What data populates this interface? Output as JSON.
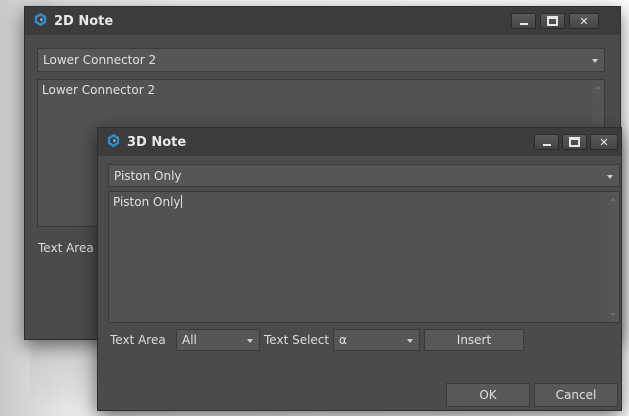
{
  "note2d": {
    "title": "2D Note",
    "dropdown_value": "Lower Connector 2",
    "text_value": "Lower Connector 2",
    "text_area_label": "Text Area"
  },
  "note3d": {
    "title": "3D Note",
    "dropdown_value": "Piston Only",
    "text_value": "Piston Only",
    "text_area_label": "Text Area",
    "text_area_value": "All",
    "text_select_label": "Text Select",
    "text_select_value": "α",
    "insert_label": "Insert",
    "ok_label": "OK",
    "cancel_label": "Cancel"
  },
  "colors": {
    "app_icon": "#2e8fd0",
    "window_bg": "#4b4b4b",
    "titlebar_bg": "#3c3c3c"
  },
  "icons": {
    "app": "cube-app-icon",
    "minimize": "minimize-icon",
    "maximize": "maximize-icon",
    "close": "close-icon"
  }
}
